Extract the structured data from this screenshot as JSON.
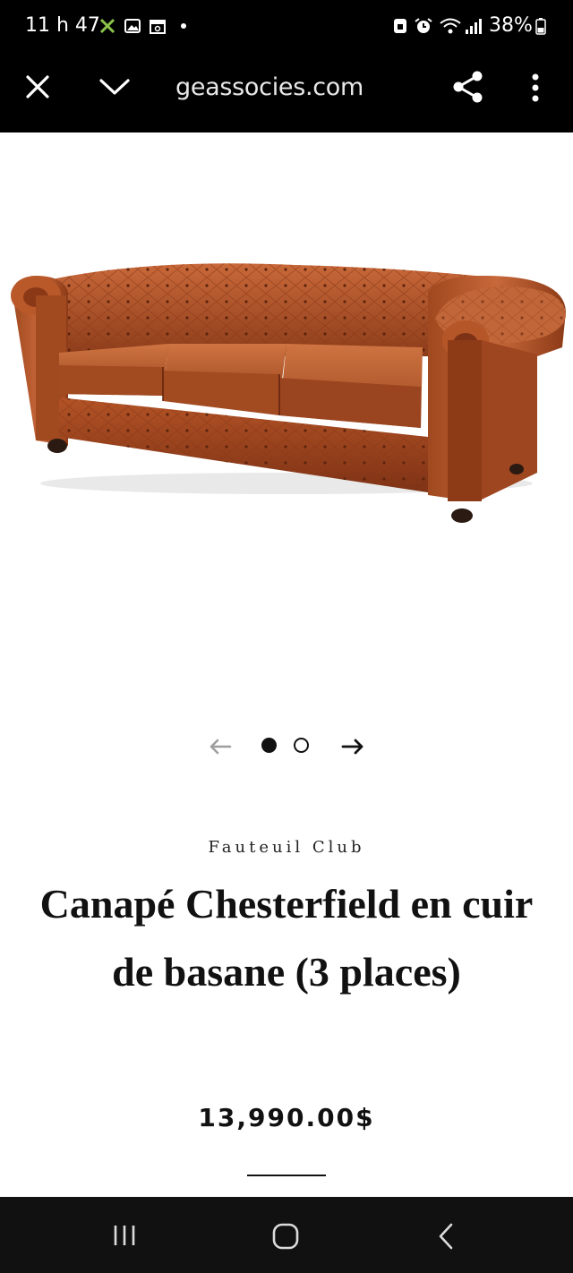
{
  "status_bar": {
    "time": "11 h 47",
    "battery": "38%"
  },
  "url_bar": {
    "url": "geassocies.com"
  },
  "product": {
    "image_alt": "Canapé Chesterfield en cuir de basane (3 places)",
    "brand": "Fauteuil Club",
    "title": "Canapé Chesterfield en cuir de basane (3 places)",
    "price": "13,990.00$"
  },
  "carousel": {
    "total": 2,
    "active": 1
  },
  "colors": {
    "leather": "#b5572a",
    "leather_dark": "#7a3216",
    "bar_bg": "#000000"
  },
  "icons": {
    "close": "close-icon",
    "collapse": "chevron-down-icon",
    "share": "share-icon",
    "more": "more-vert-icon",
    "prev": "arrow-left-icon",
    "next": "arrow-right-icon",
    "recents": "recents-icon",
    "home": "home-icon",
    "back": "back-icon"
  }
}
